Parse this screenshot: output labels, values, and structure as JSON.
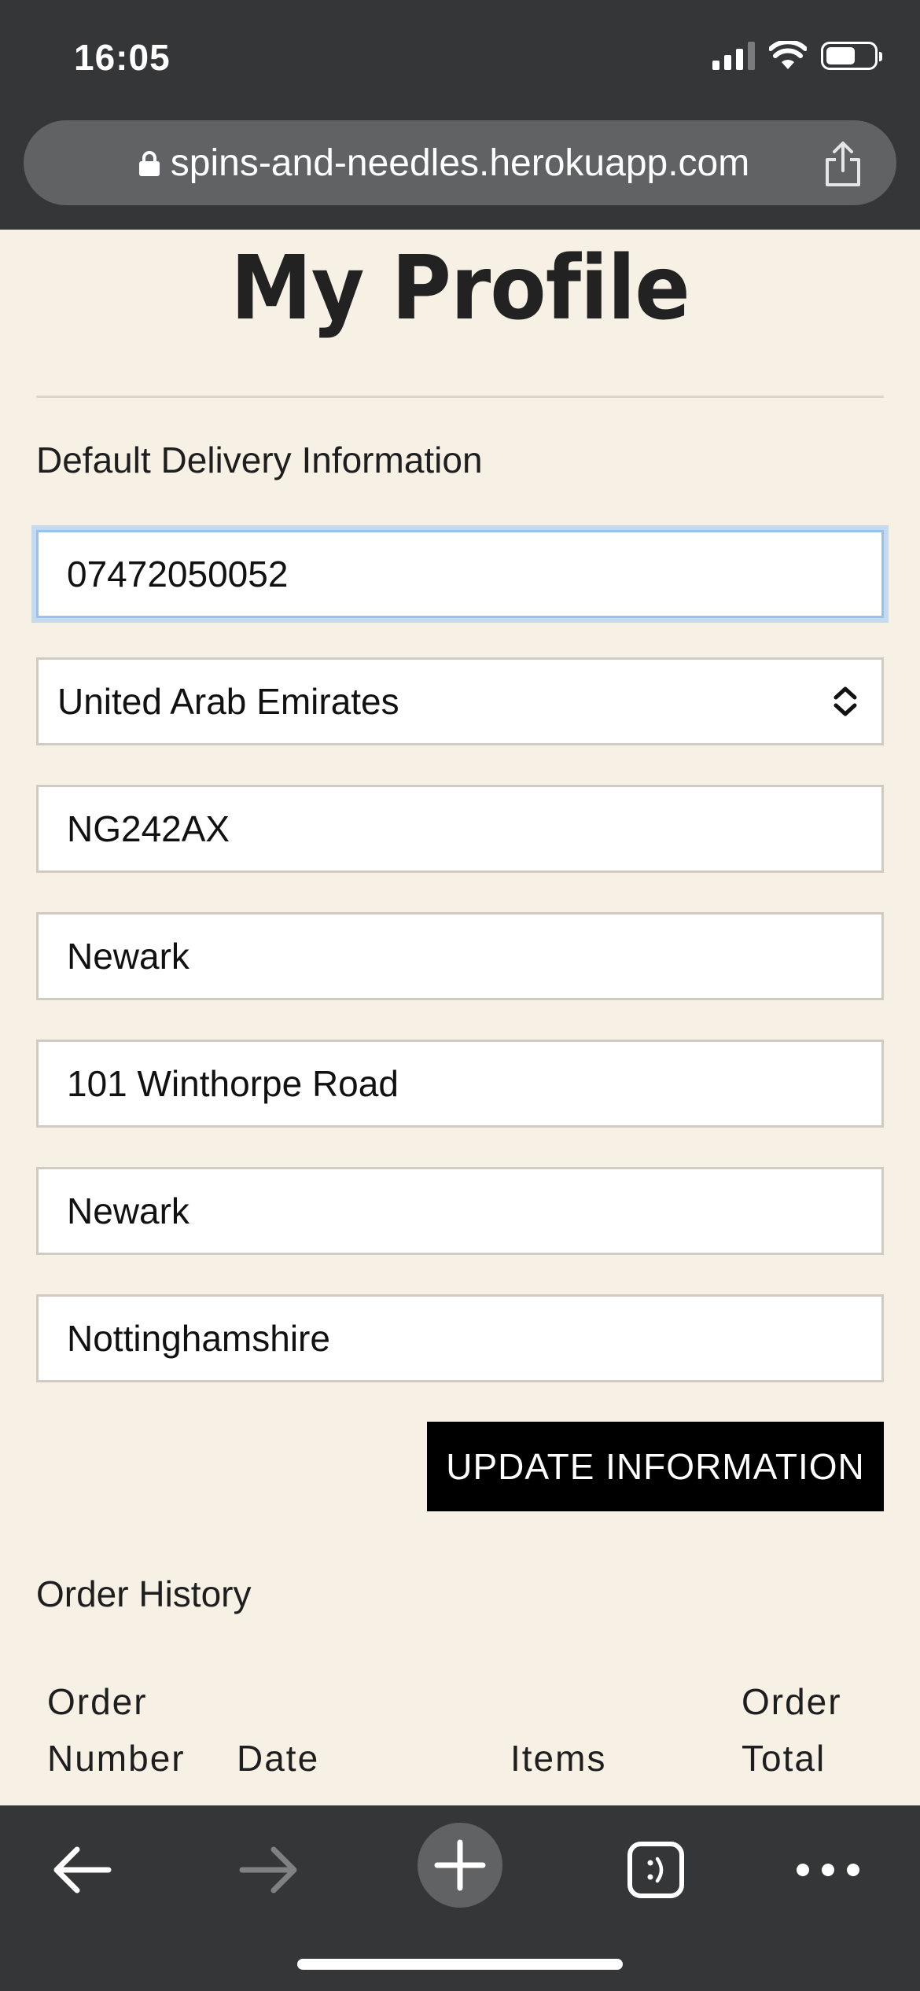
{
  "status_bar": {
    "time": "16:05"
  },
  "browser": {
    "url": "spins-and-needles.herokuapp.com"
  },
  "page": {
    "title": "My Profile",
    "delivery_section_label": "Default Delivery Information",
    "fields": {
      "phone": "07472050052",
      "country": "United Arab Emirates",
      "postcode": "NG242AX",
      "town": "Newark",
      "street_address": "101 Winthorpe Road",
      "street_address_2": "Newark",
      "county": "Nottinghamshire"
    },
    "update_button": "UPDATE INFORMATION",
    "order_history_label": "Order History",
    "order_table": {
      "headers": {
        "order_number_line1": "Order",
        "order_number_line2": "Number",
        "date": "Date",
        "items": "Items",
        "order_total_line1": "Order",
        "order_total_line2": "Total"
      }
    }
  },
  "colors": {
    "page_bg": "#f6f0e5",
    "chrome_bg": "#353638",
    "button_bg": "#000000",
    "focus_ring": "#9cc0e8"
  }
}
